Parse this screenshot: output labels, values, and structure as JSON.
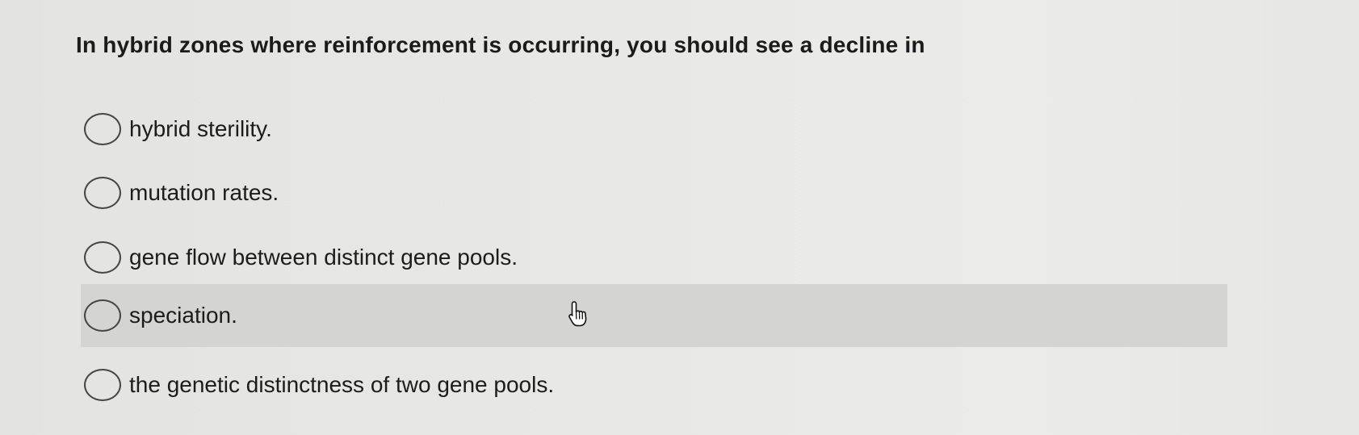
{
  "question": {
    "text": "In hybrid zones where reinforcement is occurring, you should see a decline in"
  },
  "options": [
    {
      "label": "hybrid sterility.",
      "selected": false,
      "hovered": false
    },
    {
      "label": "mutation rates.",
      "selected": false,
      "hovered": false
    },
    {
      "label": "gene flow between distinct gene pools.",
      "selected": false,
      "hovered": false
    },
    {
      "label": "speciation.",
      "selected": false,
      "hovered": true
    },
    {
      "label": "the genetic distinctness of two gene pools.",
      "selected": false,
      "hovered": false
    }
  ],
  "cursor": {
    "icon": "hand-pointer-icon"
  },
  "colors": {
    "hover_background": "#d4d4d2",
    "radio_border": "#454545",
    "text": "#1c1c1c"
  }
}
